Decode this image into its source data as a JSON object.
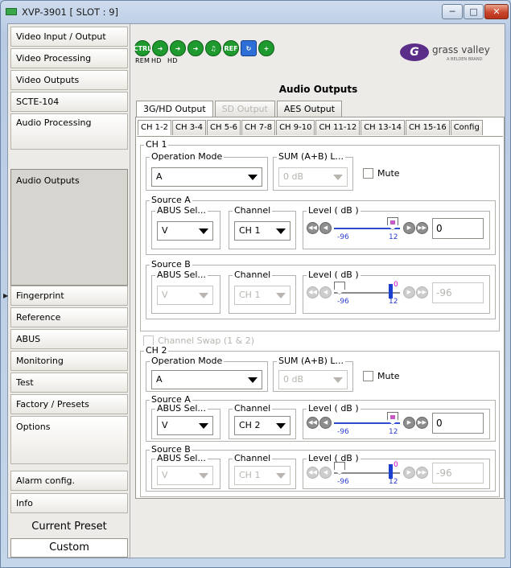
{
  "window": {
    "title": "XVP-3901 [ SLOT : 9]",
    "controls": [
      "minimize-icon",
      "maximize-icon",
      "close-icon"
    ]
  },
  "sidebar": {
    "items_top": [
      {
        "label": "Video Input / Output"
      },
      {
        "label": "Video Processing"
      },
      {
        "label": "Video Outputs"
      },
      {
        "label": "SCTE-104"
      },
      {
        "label": "Audio Processing"
      },
      {
        "label": "Audio Outputs",
        "active": true
      }
    ],
    "items_bottom": [
      {
        "label": "Fingerprint"
      },
      {
        "label": "Reference"
      },
      {
        "label": "ABUS"
      },
      {
        "label": "Monitoring"
      },
      {
        "label": "Test"
      },
      {
        "label": "Factory / Presets"
      },
      {
        "label": "Options"
      }
    ],
    "items_footer": [
      {
        "label": "Alarm config."
      },
      {
        "label": "Info"
      }
    ],
    "current_preset_label": "Current Preset",
    "current_preset_value": "Custom"
  },
  "status_icons": {
    "icons": [
      "ctrl-icon",
      "rem-icon",
      "hd-icon",
      "hd-icon",
      "audio-icon",
      "ref-icon",
      "arrow-icon",
      "plus-icon"
    ],
    "labels": [
      "REM",
      "HD",
      "HD"
    ],
    "ctrl_text": "CTRL",
    "ref_text": "REF"
  },
  "logo": {
    "brand": "grass valley",
    "sub": "A BELDEN BRAND"
  },
  "page": {
    "title": "Audio Outputs"
  },
  "tabs": [
    {
      "label": "3G/HD Output",
      "active": true
    },
    {
      "label": "SD Output",
      "disabled": true
    },
    {
      "label": "AES Output"
    }
  ],
  "subtabs": [
    {
      "label": "CH 1-2",
      "active": true
    },
    {
      "label": "CH 3-4"
    },
    {
      "label": "CH 5-6"
    },
    {
      "label": "CH 7-8"
    },
    {
      "label": "CH 9-10"
    },
    {
      "label": "CH 11-12"
    },
    {
      "label": "CH 13-14"
    },
    {
      "label": "CH 15-16"
    },
    {
      "label": "Config"
    }
  ],
  "channels": [
    {
      "title": "CH 1",
      "operation_mode_label": "Operation Mode",
      "operation_mode_value": "A",
      "sum_label": "SUM (A+B) L...",
      "sum_value": "0 dB",
      "mute_label": "Mute",
      "source_a": {
        "label": "Source A",
        "abus_label": "ABUS Sel...",
        "abus_value": "V",
        "channel_label": "Channel",
        "channel_value": "CH 1",
        "level_label": "Level ( dB )",
        "min": "-96",
        "max": "12",
        "value": "0"
      },
      "source_b": {
        "label": "Source B",
        "abus_label": "ABUS Sel...",
        "abus_value": "V",
        "channel_label": "Channel",
        "channel_value": "CH 1",
        "level_label": "Level ( dB )",
        "min": "-96",
        "max": "12",
        "marker": "0",
        "value": "-96"
      }
    },
    {
      "title": "CH 2",
      "operation_mode_label": "Operation Mode",
      "operation_mode_value": "A",
      "sum_label": "SUM (A+B) L...",
      "sum_value": "0 dB",
      "mute_label": "Mute",
      "source_a": {
        "label": "Source A",
        "abus_label": "ABUS Sel...",
        "abus_value": "V",
        "channel_label": "Channel",
        "channel_value": "CH 2",
        "level_label": "Level ( dB )",
        "min": "-96",
        "max": "12",
        "value": "0"
      },
      "source_b": {
        "label": "Source B",
        "abus_label": "ABUS Sel...",
        "abus_value": "V",
        "channel_label": "Channel",
        "channel_value": "CH 1",
        "level_label": "Level ( dB )",
        "min": "-96",
        "max": "12",
        "marker": "0",
        "value": "-96"
      }
    }
  ],
  "channel_swap_label": "Channel Swap (1 & 2)"
}
